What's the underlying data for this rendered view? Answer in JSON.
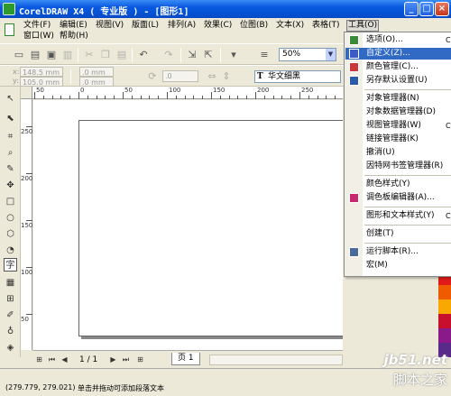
{
  "window": {
    "title": "CorelDRAW X4 ( 专业版 ) - [图形1]",
    "controls": {
      "minimize": "_",
      "maximize": "□",
      "close": "×"
    }
  },
  "menu": {
    "items": [
      {
        "label": "文件(F)"
      },
      {
        "label": "编辑(E)"
      },
      {
        "label": "视图(V)"
      },
      {
        "label": "版面(L)"
      },
      {
        "label": "排列(A)"
      },
      {
        "label": "效果(C)"
      },
      {
        "label": "位图(B)"
      },
      {
        "label": "文本(X)"
      },
      {
        "label": "表格(T)"
      },
      {
        "label": "工具(O)"
      },
      {
        "label": "窗口(W)"
      },
      {
        "label": "帮助(H)"
      }
    ]
  },
  "toolbar": {
    "zoom_value": "50%",
    "x_label": "x:",
    "x_value": "148.5 mm",
    "y_label": "y:",
    "y_value": "105.0 mm",
    "w_value": ".0 mm",
    "h_value": ".0 mm",
    "angle_value": ".0",
    "font_name": "华文细黑",
    "font_glyph": "T"
  },
  "rulers": {
    "h_labels": [
      "50",
      "0",
      "50",
      "100",
      "150",
      "200",
      "250"
    ],
    "v_labels": [
      "250",
      "200",
      "150",
      "100",
      "50"
    ]
  },
  "nav": {
    "page_count": "1 / 1",
    "page_tab": "页 1"
  },
  "status": {
    "coords": "(279.779, 279.021)",
    "hint": "单击并拖动可添加段落文本"
  },
  "tools_menu": {
    "items": [
      {
        "label": "选项(O)...",
        "shortcut": "C",
        "icon": "options-icon"
      },
      {
        "label": "自定义(Z)...",
        "shortcut": "",
        "icon": "customize-icon",
        "highlighted": true
      },
      {
        "label": "颜色管理(C)...",
        "shortcut": "",
        "icon": "color-management-icon"
      },
      {
        "label": "另存默认设置(U)",
        "shortcut": "",
        "icon": "save-defaults-icon"
      },
      {
        "label": "对象管理器(N)",
        "shortcut": "",
        "icon": ""
      },
      {
        "label": "对象数据管理器(D)",
        "shortcut": "",
        "icon": ""
      },
      {
        "label": "视图管理器(W)",
        "shortcut": "Ct",
        "icon": ""
      },
      {
        "label": "链接管理器(K)",
        "shortcut": "",
        "icon": ""
      },
      {
        "label": "撤消(U)",
        "shortcut": "",
        "icon": ""
      },
      {
        "label": "因特网书签管理器(R)",
        "shortcut": "",
        "icon": ""
      },
      {
        "label": "颜色样式(Y)",
        "shortcut": "",
        "icon": ""
      },
      {
        "label": "调色板编辑器(A)...",
        "shortcut": "",
        "icon": "palette-editor-icon"
      },
      {
        "label": "图形和文本样式(Y)",
        "shortcut": "Ct",
        "icon": ""
      },
      {
        "label": "创建(T)",
        "shortcut": "",
        "icon": ""
      },
      {
        "label": "运行脚本(R)...",
        "shortcut": "",
        "icon": "run-script-icon"
      },
      {
        "label": "宏(M)",
        "shortcut": "",
        "icon": ""
      }
    ]
  },
  "palette_colors": [
    "#e01a1a",
    "#f05a00",
    "#f8a800",
    "#c8102e",
    "#8a1a8a",
    "#5a2a8a"
  ],
  "watermark": {
    "site": "jb51.net",
    "name": "脚本之家"
  }
}
